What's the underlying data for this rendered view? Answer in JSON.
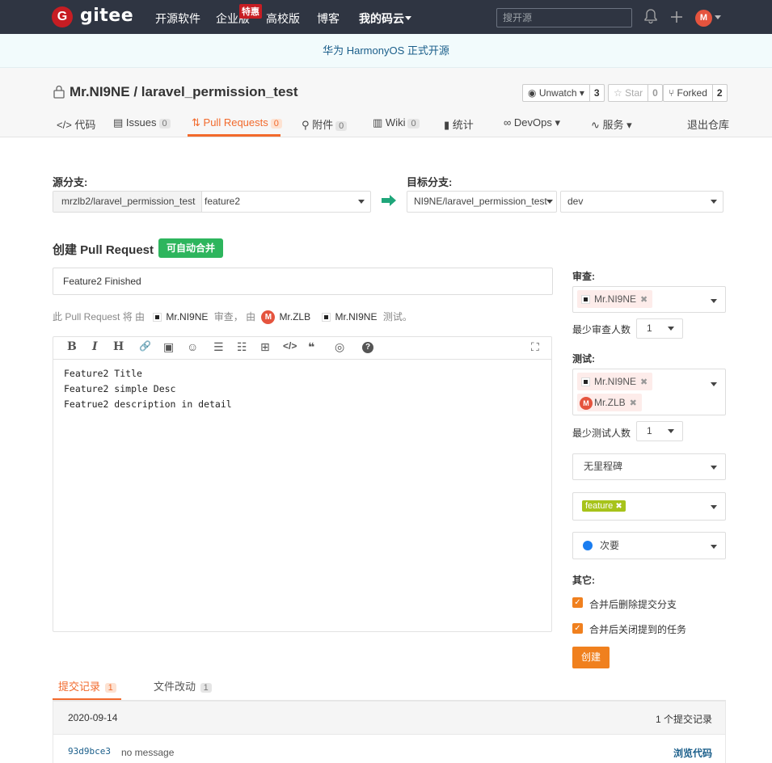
{
  "nav": {
    "logo_letter": "G",
    "logo": "gitee",
    "links": [
      "开源软件",
      "企业版",
      "高校版",
      "博客",
      "我的码云"
    ],
    "badge": "特惠",
    "search_placeholder": "搜开源",
    "avatar_letter": "M"
  },
  "banner": {
    "text": "华为 HarmonyOS 正式开源"
  },
  "project": {
    "title": "Mr.NI9NE / laravel_permission_test",
    "watch_label": "Unwatch",
    "watch_count": "3",
    "star_label": "Star",
    "star_count": "0",
    "fork_label": "Forked",
    "fork_count": "2",
    "exit": "退出仓库"
  },
  "tabs": [
    {
      "label": "代码",
      "icon": "code-icon"
    },
    {
      "label": "Issues",
      "count": "0",
      "icon": "issues-icon"
    },
    {
      "label": "Pull Requests",
      "count": "0",
      "icon": "pr-icon"
    },
    {
      "label": "附件",
      "count": "0",
      "icon": "attach-icon"
    },
    {
      "label": "Wiki",
      "count": "0",
      "icon": "wiki-icon"
    },
    {
      "label": "统计",
      "icon": "stats-icon"
    },
    {
      "label": "DevOps",
      "icon": "devops-icon"
    },
    {
      "label": "服务",
      "icon": "service-icon"
    }
  ],
  "form": {
    "source_label": "源分支:",
    "source_repo": "mrzlb2/laravel_permission_test",
    "source_branch": "feature2",
    "target_label": "目标分支:",
    "target_repo": "NI9NE/laravel_permission_test",
    "target_branch": "dev",
    "heading": "创建 Pull Request",
    "merge_badge": "可自动合并",
    "title_value": "Feature2 Finished",
    "info_prefix": "此 Pull Request 将 由",
    "info_user1": "Mr.NI9NE",
    "info_mid1": "审查， 由",
    "info_avatar": "M",
    "info_user2": "Mr.ZLB",
    "info_user3": "Mr.NI9NE",
    "info_suffix": "测试。",
    "toolbar": {
      "bold": "B",
      "italic": "I",
      "heading": "H",
      "link": "🔗",
      "image": "▣",
      "emoji": "☺",
      "ul": "☰",
      "ol": "☷",
      "table": "⊞",
      "code": "</>",
      "quote": "❝",
      "preview": "◎",
      "help": "?",
      "fullscreen": "⛶"
    },
    "body_lines": [
      "Feature2 Title",
      "Feature2 simple Desc",
      "Featrue2 description in detail"
    ]
  },
  "sidebar": {
    "review_label": "审查:",
    "reviewer": "Mr.NI9NE",
    "min_review_label": "最少审查人数",
    "min_review": "1",
    "test_label": "测试:",
    "tester1": "Mr.NI9NE",
    "tester2": "Mr.ZLB",
    "tester2_avatar": "M",
    "min_test_label": "最少测试人数",
    "min_test": "1",
    "milestone": "无里程碑",
    "label_tag": "feature",
    "label_tag_x": "✖",
    "tag_x": "✖",
    "priority": "次要",
    "other_label": "其它:",
    "opt1": "合并后删除提交分支",
    "opt2": "合并后关闭提到的任务",
    "create_button": "创建",
    "accent": "#f0801e"
  },
  "bottom": {
    "tab1": "提交记录",
    "tab1_count": "1",
    "tab2": "文件改动",
    "tab2_count": "1",
    "date": "2020-09-14",
    "summary": "1 个提交记录",
    "hash": "93d9bce3",
    "message": "no message",
    "browse": "浏览代码"
  }
}
